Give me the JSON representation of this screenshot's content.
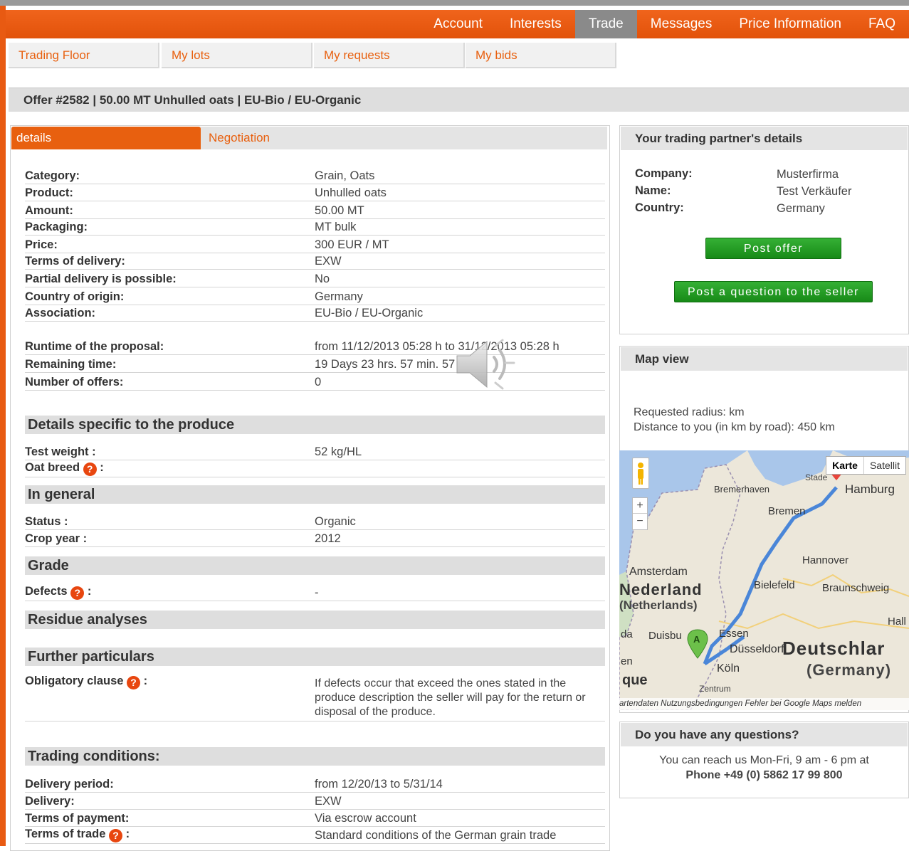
{
  "nav": {
    "items": [
      {
        "label": "Account"
      },
      {
        "label": "Interests"
      },
      {
        "label": "Trade"
      },
      {
        "label": "Messages"
      },
      {
        "label": "Price Information"
      },
      {
        "label": "FAQ"
      }
    ],
    "active": "Trade"
  },
  "subnav": {
    "items": [
      {
        "label": "Trading Floor"
      },
      {
        "label": "My lots"
      },
      {
        "label": "My requests"
      },
      {
        "label": "My bids"
      }
    ]
  },
  "offer_title": "Offer #2582 | 50.00 MT Unhulled oats | EU-Bio / EU-Organic",
  "tabs": {
    "details": "details",
    "negotiation": "Negotiation"
  },
  "details": [
    {
      "label": "Category:",
      "value": "Grain, Oats"
    },
    {
      "label": "Product:",
      "value": "Unhulled oats"
    },
    {
      "label": "Amount:",
      "value": "50.00 MT"
    },
    {
      "label": "Packaging:",
      "value": "MT bulk"
    },
    {
      "label": "Price:",
      "value": "300 EUR / MT"
    },
    {
      "label": "Terms of delivery:",
      "value": "EXW"
    },
    {
      "label": "Partial delivery is possible:",
      "value": "No"
    },
    {
      "label": "Country of origin:",
      "value": "Germany"
    },
    {
      "label": "Association:",
      "value": "EU-Bio / EU-Organic"
    }
  ],
  "runtime": [
    {
      "label": "Runtime of the proposal:",
      "value": "from 11/12/2013 05:28 h to 31/12/2013 05:28 h"
    },
    {
      "label": "Remaining time:",
      "value": "19 Days 23 hrs. 57 min. 57"
    },
    {
      "label": "Number of offers:",
      "value": "0"
    }
  ],
  "sections": {
    "produce": "Details specific to the produce",
    "general": "In general",
    "grade": "Grade",
    "residue": "Residue analyses",
    "further": "Further particulars",
    "trading": "Trading conditions:"
  },
  "produce": [
    {
      "label": "Test weight :",
      "value": "52 kg/HL"
    },
    {
      "label": "Oat breed",
      "suffix": ":",
      "value": ""
    }
  ],
  "general": [
    {
      "label": "Status  :",
      "value": "Organic"
    },
    {
      "label": "Crop year :",
      "value": "2012"
    }
  ],
  "grade": [
    {
      "label": "Defects",
      "suffix": ":",
      "value": "-"
    }
  ],
  "further": {
    "label": "Obligatory clause",
    "suffix": ":",
    "value": "If defects occur that exceed the ones stated in the produce description the seller will pay for the return or disposal of the produce."
  },
  "trading": [
    {
      "label": "Delivery period:",
      "value": "from 12/20/13 to 5/31/14"
    },
    {
      "label": "Delivery:",
      "value": "EXW"
    },
    {
      "label": "Terms of payment:",
      "value": "Via escrow account"
    },
    {
      "label": "Terms of trade",
      "suffix": ":",
      "value": "Standard conditions of the German grain trade"
    }
  ],
  "help_glyph": "?",
  "partner": {
    "title": "Your trading partner's details",
    "rows": [
      {
        "label": "Company:",
        "value": "Musterfirma"
      },
      {
        "label": "Name:",
        "value": "Test Verkäufer"
      },
      {
        "label": "Country:",
        "value": "Germany"
      }
    ],
    "post_offer": "Post offer",
    "post_question": "Post a question to the seller"
  },
  "map": {
    "title": "Map view",
    "radius": "Requested radius:  km",
    "distance": "Distance to you (in km by road): 450 km",
    "type_map": "Karte",
    "type_sat": "Satellit",
    "zoom_in": "+",
    "zoom_out": "−",
    "marker_a": "A",
    "footer": "artendaten   Nutzungsbedingungen     Fehler bei Google Maps melden",
    "places": {
      "hamburg": "Hamburg",
      "stade": "Stade",
      "bremerhaven": "Bremerhaven",
      "bremen": "Bremen",
      "hannover": "Hannover",
      "amsterdam": "Amsterdam",
      "nederland": "Nederland",
      "netherlands": "(Netherlands)",
      "bielefeld": "Bielefeld",
      "braunschweig": "Braunschweig",
      "essen": "Essen",
      "duisburg": "Duisbu",
      "duesseldorf": "Düsseldorf",
      "koeln": "Köln",
      "zentrum": "Zentrum",
      "deutschland": "Deutschlar",
      "germany": "(Germany)",
      "halle": "Hall",
      "en": "en",
      "que": "que",
      "ida": "da"
    }
  },
  "questions": {
    "title": "Do you have any questions?",
    "line1": "You can reach us Mon-Fri, 9 am - 6 pm at",
    "line2": "Phone +49 (0) 5862 17 99 800"
  },
  "colors": {
    "accent": "#e8600f",
    "button_green": "#1f9a1f",
    "header_grey": "#dedede"
  }
}
